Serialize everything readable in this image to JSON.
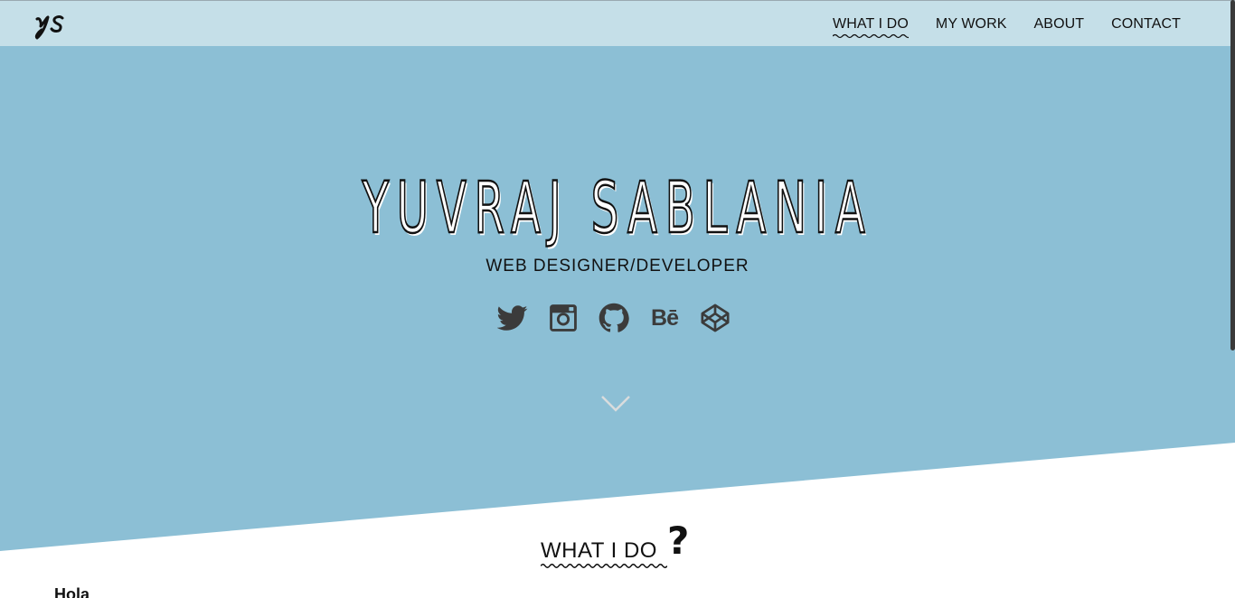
{
  "logo": {
    "text": "ys"
  },
  "nav": {
    "items": [
      {
        "label": "WHAT I DO",
        "active": true
      },
      {
        "label": "MY WORK"
      },
      {
        "label": "ABOUT"
      },
      {
        "label": "CONTACT"
      }
    ]
  },
  "hero": {
    "title": "YUVRAJ SABLANIA",
    "subtitle": "WEB DESIGNER/DEVELOPER",
    "socials": [
      {
        "icon": "twitter-icon"
      },
      {
        "icon": "instagram-icon"
      },
      {
        "icon": "github-icon"
      },
      {
        "icon": "behance-icon",
        "text": "Bē"
      },
      {
        "icon": "codepen-icon"
      }
    ],
    "scroll_icon": "chevron-down-icon"
  },
  "section": {
    "title": "WHAT I DO",
    "question_mark": "?",
    "intro": "Hola"
  },
  "colors": {
    "hero_bg": "#8cbfd5",
    "nav_bg": "#c5dfe8",
    "text": "#111111",
    "icon": "#3b3b3b"
  }
}
